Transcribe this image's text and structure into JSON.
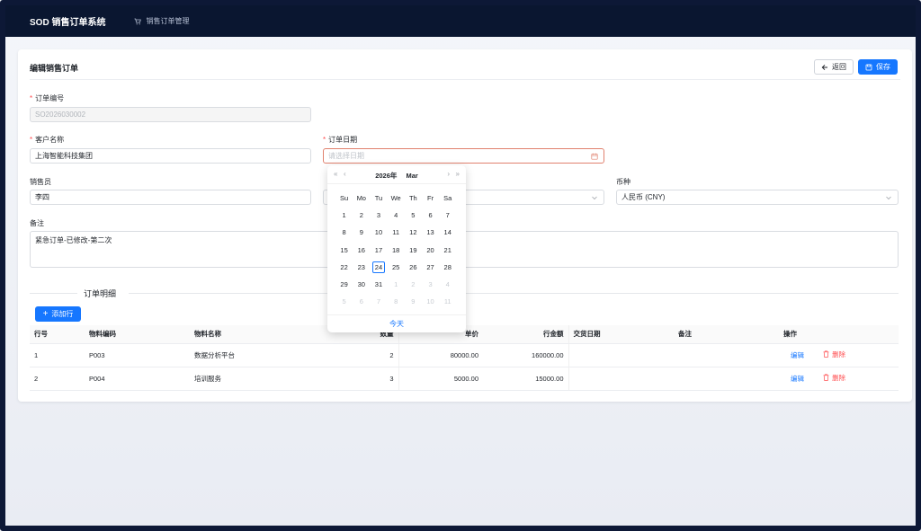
{
  "app": {
    "title": "SOD 销售订单系统",
    "nav_item": "销售订单管理",
    "nav_icon": "cart-icon"
  },
  "page": {
    "title": "编辑销售订单",
    "back_label": "返回",
    "save_label": "保存"
  },
  "form": {
    "order_no": {
      "label": "订单编号",
      "value": "SO2026030002"
    },
    "customer": {
      "label": "客户名称",
      "value": "上海智能科技集团"
    },
    "order_date": {
      "label": "订单日期",
      "placeholder": "请选择日期"
    },
    "salesperson": {
      "label": "销售员",
      "value": "李四"
    },
    "currency": {
      "label": "币种",
      "value": "人民币 (CNY)"
    },
    "remark": {
      "label": "备注",
      "value": "紧急订单-已修改-第二次"
    }
  },
  "details": {
    "section_title": "订单明细",
    "add_row_label": "添加行",
    "columns": [
      "行号",
      "物料编码",
      "物料名称",
      "数量",
      "单价",
      "行金额",
      "交货日期",
      "备注",
      "操作"
    ],
    "rows": [
      {
        "line": "1",
        "code": "P003",
        "name": "数据分析平台",
        "qty": "2",
        "price": "80000.00",
        "amount": "160000.00",
        "delivery": "",
        "remark": "",
        "edit": "编辑",
        "delete": "删除"
      },
      {
        "line": "2",
        "code": "P004",
        "name": "培训服务",
        "qty": "3",
        "price": "5000.00",
        "amount": "15000.00",
        "delivery": "",
        "remark": "",
        "edit": "编辑",
        "delete": "删除"
      }
    ]
  },
  "datepicker": {
    "year": "2026年",
    "month": "Mar",
    "weekdays": [
      "Su",
      "Mo",
      "Tu",
      "We",
      "Th",
      "Fr",
      "Sa"
    ],
    "weeks": [
      [
        "1",
        "2",
        "3",
        "4",
        "5",
        "6",
        "7"
      ],
      [
        "8",
        "9",
        "10",
        "11",
        "12",
        "13",
        "14"
      ],
      [
        "15",
        "16",
        "17",
        "18",
        "19",
        "20",
        "21"
      ],
      [
        "22",
        "23",
        "24",
        "25",
        "26",
        "27",
        "28"
      ],
      [
        "29",
        "30",
        "31",
        "1",
        "2",
        "3",
        "4"
      ],
      [
        "5",
        "6",
        "7",
        "8",
        "9",
        "10",
        "11"
      ]
    ],
    "today_label": "今天",
    "today_day": "24"
  },
  "colors": {
    "primary": "#1677ff",
    "topbar": "#0a1630",
    "danger": "#ff4d4f"
  }
}
